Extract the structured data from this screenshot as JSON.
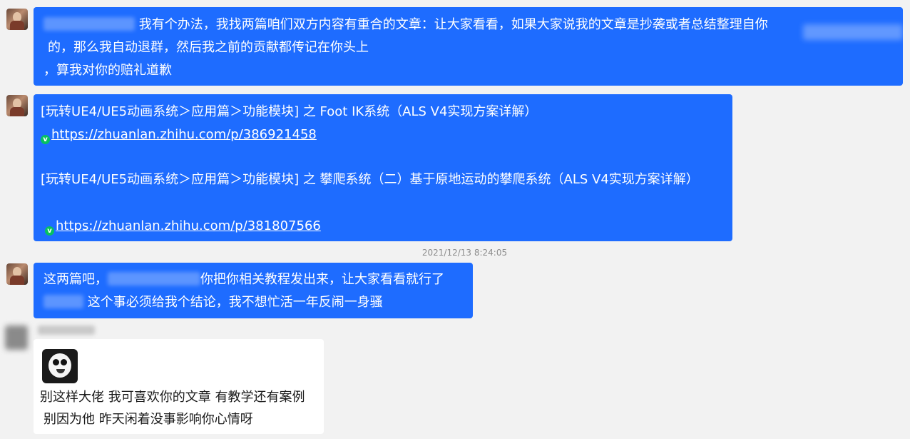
{
  "colors": {
    "background": "#f2f2f2",
    "bubble_blue": "#1e6cff",
    "bubble_white": "#ffffff",
    "timestamp_text": "#8c8c8c",
    "wechat_badge": "#07c160"
  },
  "messages": [
    {
      "sender": "other-avatar-1",
      "lines": [
        "我有个办法，我找两篇咱们双方内容有重合的文章：让大家看看，如果大家说我的文章是抄袭或者总结整理自你",
        "的，那么我自动退群，然后我之前的贡献都传记在你头上",
        "，算我对你的赔礼道歉"
      ]
    },
    {
      "sender": "other-avatar-1",
      "article1_title": "[玩转UE4/UE5动画系统＞应用篇＞功能模块] 之 Foot IK系统（ALS V4实现方案详解）",
      "article1_url": "https://zhuanlan.zhihu.com/p/386921458",
      "article2_title": "[玩转UE4/UE5动画系统＞应用篇＞功能模块] 之 攀爬系统（二）基于原地运动的攀爬系统（ALS V4实现方案详解）",
      "article2_url": "https://zhuanlan.zhihu.com/p/381807566",
      "badge_label": "v"
    },
    {
      "timestamp": "2021/12/13 8:24:05"
    },
    {
      "sender": "other-avatar-1",
      "line1_prefix": "这两篇吧，",
      "line1_suffix": "你把你相关教程发出来，让大家看看就行了",
      "line2_suffix": "这个事必须给我个结论，我不想忙活一年反闹一身骚"
    },
    {
      "sender": "other-avatar-2",
      "sticker": "panda-meme-sticker",
      "lines": [
        "别这样大佬 我可喜欢你的文章 有教学还有案例",
        "别因为他 昨天闲着没事影响你心情呀"
      ]
    }
  ]
}
